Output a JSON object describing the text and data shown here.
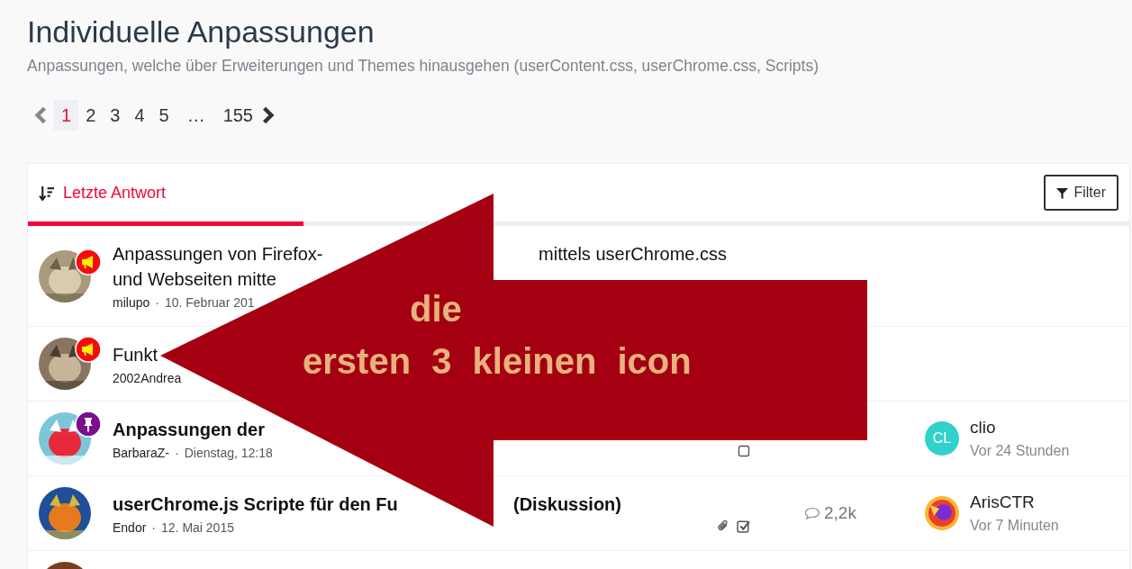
{
  "header": {
    "title": "Individuelle Anpassungen",
    "subtitle": "Anpassungen, welche über Erweiterungen und Themes hinausgehen (userContent.css, userChrome.css, Scripts)"
  },
  "pagination": {
    "prev_disabled": true,
    "pages": [
      {
        "label": "1",
        "selected": true
      },
      {
        "label": "2",
        "selected": false
      },
      {
        "label": "3",
        "selected": false
      },
      {
        "label": "4",
        "selected": false
      },
      {
        "label": "5",
        "selected": false
      },
      {
        "label": "…",
        "kind": "ellipsis"
      },
      {
        "label": "155",
        "selected": false
      }
    ]
  },
  "sort_tab": {
    "label": "Letzte Antwort",
    "selected": true
  },
  "filter_button": {
    "label": "Filter"
  },
  "threads": [
    {
      "avatar": {
        "kind": "picture"
      },
      "badge": {
        "kind": "announcement"
      },
      "unread": false,
      "title_lines": [
        [
          "Anpassungen von Firefox-",
          "mittels userChrome.css"
        ],
        [
          "und Webseiten mitte"
        ]
      ],
      "author": "milupo",
      "separator": "·",
      "date": "10. Februar 201"
    },
    {
      "avatar": {
        "kind": "picture"
      },
      "badge": {
        "kind": "announcement"
      },
      "unread": false,
      "title_lines": [
        [
          "Funkt"
        ]
      ],
      "author": "2002Andrea"
    },
    {
      "avatar": {
        "kind": "picture"
      },
      "badge": {
        "kind": "sticky"
      },
      "unread": true,
      "title_lines": [
        [
          "Anpassungen der"
        ]
      ],
      "author": "BarbaraZ-",
      "separator": "·",
      "date": "Dienstag, 12:18",
      "stats": {
        "solved": false
      },
      "last_post": {
        "name": "clio",
        "time": "Vor 24 Stunden",
        "avatar": {
          "kind": "initials",
          "initials": "CL",
          "color": "#33d1cc"
        }
      }
    },
    {
      "avatar": {
        "kind": "picture"
      },
      "unread": true,
      "title_lines": [
        [
          "userChrome.js Scripte für den Fu",
          "(Diskussion)"
        ]
      ],
      "author": "Endor",
      "separator": "·",
      "date": "12. Mai 2015",
      "stats": {
        "attachment": true,
        "solved": true,
        "replies": "2,2k"
      },
      "last_post": {
        "name": "ArisCTR",
        "time": "Vor 7 Minuten",
        "avatar": {
          "kind": "picture"
        }
      }
    },
    {
      "avatar": {
        "kind": "picture"
      }
    }
  ],
  "annotation": {
    "lines": [
      "die",
      "ersten 3 kleinen icon"
    ]
  }
}
